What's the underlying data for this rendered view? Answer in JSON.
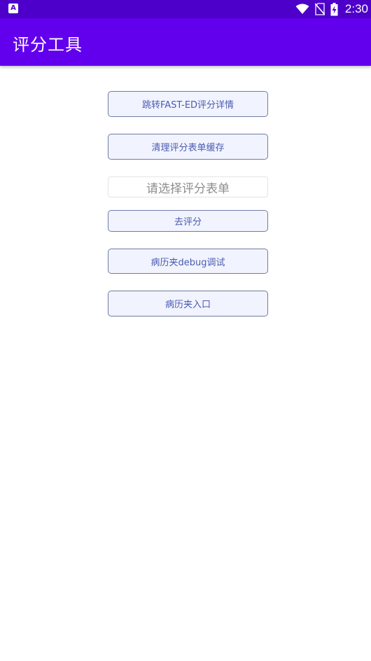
{
  "status_bar": {
    "app_icon_letter": "A",
    "time": "2:30",
    "icons": [
      "wifi-icon",
      "no-sim-icon",
      "battery-charging-icon"
    ]
  },
  "app_bar": {
    "title": "评分工具"
  },
  "buttons": {
    "jump_fast_ed": "跳转FAST-ED评分详情",
    "clear_cache": "清理评分表单缓存",
    "go_score": "去评分",
    "record_debug": "病历夹debug调试",
    "record_entry": "病历夹入口"
  },
  "form_select": {
    "placeholder": "请选择评分表单"
  },
  "colors": {
    "status_bar": "#4d00c9",
    "app_bar": "#6200ee",
    "button_bg": "#f1f3fe",
    "button_border": "#6f7ba4",
    "button_text": "#4a5bb0"
  }
}
